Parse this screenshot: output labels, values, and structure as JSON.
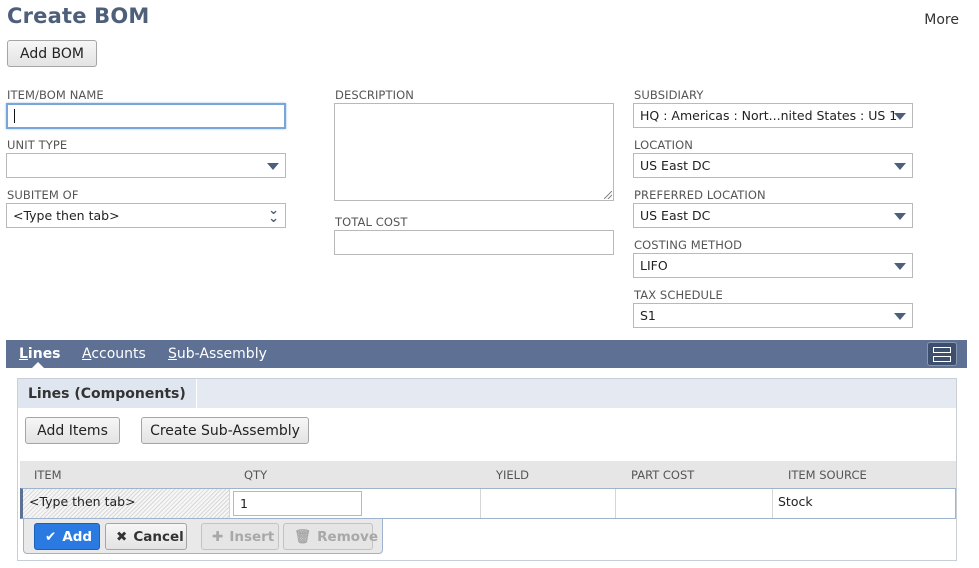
{
  "header": {
    "title": "Create BOM",
    "more_label": "More"
  },
  "toolbar": {
    "add_bom_label": "Add BOM"
  },
  "form": {
    "item_bom_name": {
      "label": "ITEM/BOM NAME",
      "value": ""
    },
    "unit_type": {
      "label": "UNIT TYPE",
      "value": ""
    },
    "subitem_of": {
      "label": "SUBITEM OF",
      "value": "<Type then tab>"
    },
    "description": {
      "label": "DESCRIPTION",
      "value": ""
    },
    "total_cost": {
      "label": "TOTAL COST",
      "value": ""
    },
    "subsidiary": {
      "label": "SUBSIDIARY",
      "value": "HQ : Americas : Nort...nited States : US 1"
    },
    "location": {
      "label": "LOCATION",
      "value": "US East DC"
    },
    "preferred_location": {
      "label": "PREFERRED LOCATION",
      "value": "US East DC"
    },
    "costing_method": {
      "label": "COSTING METHOD",
      "value": "LIFO"
    },
    "tax_schedule": {
      "label": "TAX SCHEDULE",
      "value": "S1"
    }
  },
  "tabs": {
    "lines": {
      "first": "L",
      "rest": "ines"
    },
    "accounts": {
      "first": "A",
      "rest": "ccounts"
    },
    "subassembly": {
      "first": "S",
      "rest": "ub-Assembly"
    }
  },
  "lines_panel": {
    "subtab_label": "Lines (Components)",
    "add_items_label": "Add Items",
    "create_subassembly_label": "Create Sub-Assembly",
    "columns": {
      "item": "ITEM",
      "qty": "QTY",
      "yield": "YIELD",
      "part_cost": "PART COST",
      "item_source": "ITEM SOURCE"
    },
    "row": {
      "item": "<Type then tab>",
      "qty": "1",
      "yield": "",
      "part_cost": "",
      "item_source": "Stock"
    },
    "actions": {
      "add": "Add",
      "cancel": "Cancel",
      "insert": "Insert",
      "remove": "Remove"
    }
  },
  "colors": {
    "accent_blue": "#2a7ae2",
    "tab_bar": "#5e7194",
    "title": "#4d5f79"
  }
}
